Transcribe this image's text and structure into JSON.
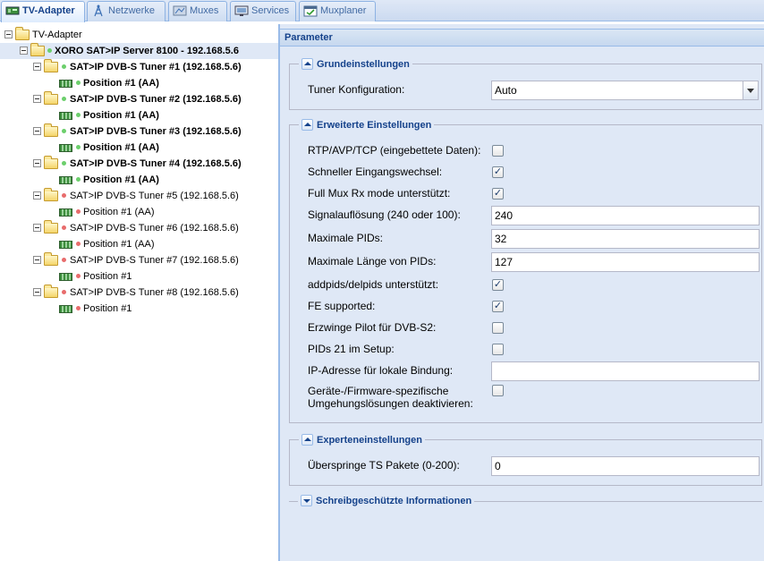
{
  "tabs": [
    {
      "label": "TV-Adapter",
      "icon": "tv-adapter-icon",
      "active": true
    },
    {
      "label": "Netzwerke",
      "icon": "antenna-icon",
      "active": false
    },
    {
      "label": "Muxes",
      "icon": "muxes-icon",
      "active": false
    },
    {
      "label": "Services",
      "icon": "tv-icon",
      "active": false
    },
    {
      "label": "Muxplaner",
      "icon": "calendar-check-icon",
      "active": false
    }
  ],
  "tree": {
    "root": "TV-Adapter",
    "server": "XORO SAT>IP Server 8100 - 192.168.5.6",
    "tuners": [
      {
        "label": "SAT>IP DVB-S Tuner #1 (192.168.5.6)",
        "position": "Position #1 (AA)",
        "status": "green"
      },
      {
        "label": "SAT>IP DVB-S Tuner #2 (192.168.5.6)",
        "position": "Position #1 (AA)",
        "status": "green"
      },
      {
        "label": "SAT>IP DVB-S Tuner #3 (192.168.5.6)",
        "position": "Position #1 (AA)",
        "status": "green"
      },
      {
        "label": "SAT>IP DVB-S Tuner #4 (192.168.5.6)",
        "position": "Position #1 (AA)",
        "status": "green"
      },
      {
        "label": "SAT>IP DVB-S Tuner #5 (192.168.5.6)",
        "position": "Position #1 (AA)",
        "status": "red"
      },
      {
        "label": "SAT>IP DVB-S Tuner #6 (192.168.5.6)",
        "position": "Position #1 (AA)",
        "status": "red"
      },
      {
        "label": "SAT>IP DVB-S Tuner #7 (192.168.5.6)",
        "position": "Position #1",
        "status": "red"
      },
      {
        "label": "SAT>IP DVB-S Tuner #8 (192.168.5.6)",
        "position": "Position #1",
        "status": "red"
      }
    ]
  },
  "panel": {
    "title": "Parameter",
    "basic": {
      "legend": "Grundeinstellungen",
      "tuner_config_label": "Tuner Konfiguration:",
      "tuner_config_value": "Auto"
    },
    "advanced": {
      "legend": "Erweiterte Einstellungen",
      "rtp_label": "RTP/AVP/TCP (eingebettete Daten):",
      "rtp_checked": false,
      "fast_switch_label": "Schneller Eingangswechsel:",
      "fast_switch_checked": true,
      "fullmux_label": "Full Mux Rx mode unterstützt:",
      "fullmux_checked": true,
      "signal_label": "Signalauflösung (240 oder 100):",
      "signal_value": "240",
      "maxpids_label": "Maximale PIDs:",
      "maxpids_value": "32",
      "maxpidlen_label": "Maximale Länge von PIDs:",
      "maxpidlen_value": "127",
      "addpids_label": "addpids/delpids unterstützt:",
      "addpids_checked": true,
      "fe_label": "FE supported:",
      "fe_checked": true,
      "pilot_label": "Erzwinge Pilot für DVB-S2:",
      "pilot_checked": false,
      "pids21_label": "PIDs 21 im Setup:",
      "pids21_checked": false,
      "bind_label": "IP-Adresse für lokale Bindung:",
      "bind_value": "",
      "workaround_label_line1": "Geräte-/Firmware-spezifische",
      "workaround_label_line2": "Umgehungslösungen deaktivieren:",
      "workaround_checked": false
    },
    "expert": {
      "legend": "Experteneinstellungen",
      "skip_ts_label": "Überspringe TS Pakete (0-200):",
      "skip_ts_value": "0"
    },
    "readonly": {
      "legend": "Schreibgeschützte Informationen"
    }
  }
}
